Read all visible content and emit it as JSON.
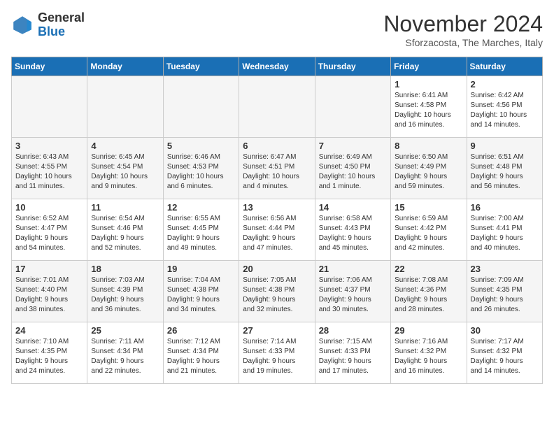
{
  "logo": {
    "general": "General",
    "blue": "Blue"
  },
  "title": "November 2024",
  "subtitle": "Sforzacosta, The Marches, Italy",
  "headers": [
    "Sunday",
    "Monday",
    "Tuesday",
    "Wednesday",
    "Thursday",
    "Friday",
    "Saturday"
  ],
  "weeks": [
    [
      {
        "day": "",
        "info": ""
      },
      {
        "day": "",
        "info": ""
      },
      {
        "day": "",
        "info": ""
      },
      {
        "day": "",
        "info": ""
      },
      {
        "day": "",
        "info": ""
      },
      {
        "day": "1",
        "info": "Sunrise: 6:41 AM\nSunset: 4:58 PM\nDaylight: 10 hours\nand 16 minutes."
      },
      {
        "day": "2",
        "info": "Sunrise: 6:42 AM\nSunset: 4:56 PM\nDaylight: 10 hours\nand 14 minutes."
      }
    ],
    [
      {
        "day": "3",
        "info": "Sunrise: 6:43 AM\nSunset: 4:55 PM\nDaylight: 10 hours\nand 11 minutes."
      },
      {
        "day": "4",
        "info": "Sunrise: 6:45 AM\nSunset: 4:54 PM\nDaylight: 10 hours\nand 9 minutes."
      },
      {
        "day": "5",
        "info": "Sunrise: 6:46 AM\nSunset: 4:53 PM\nDaylight: 10 hours\nand 6 minutes."
      },
      {
        "day": "6",
        "info": "Sunrise: 6:47 AM\nSunset: 4:51 PM\nDaylight: 10 hours\nand 4 minutes."
      },
      {
        "day": "7",
        "info": "Sunrise: 6:49 AM\nSunset: 4:50 PM\nDaylight: 10 hours\nand 1 minute."
      },
      {
        "day": "8",
        "info": "Sunrise: 6:50 AM\nSunset: 4:49 PM\nDaylight: 9 hours\nand 59 minutes."
      },
      {
        "day": "9",
        "info": "Sunrise: 6:51 AM\nSunset: 4:48 PM\nDaylight: 9 hours\nand 56 minutes."
      }
    ],
    [
      {
        "day": "10",
        "info": "Sunrise: 6:52 AM\nSunset: 4:47 PM\nDaylight: 9 hours\nand 54 minutes."
      },
      {
        "day": "11",
        "info": "Sunrise: 6:54 AM\nSunset: 4:46 PM\nDaylight: 9 hours\nand 52 minutes."
      },
      {
        "day": "12",
        "info": "Sunrise: 6:55 AM\nSunset: 4:45 PM\nDaylight: 9 hours\nand 49 minutes."
      },
      {
        "day": "13",
        "info": "Sunrise: 6:56 AM\nSunset: 4:44 PM\nDaylight: 9 hours\nand 47 minutes."
      },
      {
        "day": "14",
        "info": "Sunrise: 6:58 AM\nSunset: 4:43 PM\nDaylight: 9 hours\nand 45 minutes."
      },
      {
        "day": "15",
        "info": "Sunrise: 6:59 AM\nSunset: 4:42 PM\nDaylight: 9 hours\nand 42 minutes."
      },
      {
        "day": "16",
        "info": "Sunrise: 7:00 AM\nSunset: 4:41 PM\nDaylight: 9 hours\nand 40 minutes."
      }
    ],
    [
      {
        "day": "17",
        "info": "Sunrise: 7:01 AM\nSunset: 4:40 PM\nDaylight: 9 hours\nand 38 minutes."
      },
      {
        "day": "18",
        "info": "Sunrise: 7:03 AM\nSunset: 4:39 PM\nDaylight: 9 hours\nand 36 minutes."
      },
      {
        "day": "19",
        "info": "Sunrise: 7:04 AM\nSunset: 4:38 PM\nDaylight: 9 hours\nand 34 minutes."
      },
      {
        "day": "20",
        "info": "Sunrise: 7:05 AM\nSunset: 4:38 PM\nDaylight: 9 hours\nand 32 minutes."
      },
      {
        "day": "21",
        "info": "Sunrise: 7:06 AM\nSunset: 4:37 PM\nDaylight: 9 hours\nand 30 minutes."
      },
      {
        "day": "22",
        "info": "Sunrise: 7:08 AM\nSunset: 4:36 PM\nDaylight: 9 hours\nand 28 minutes."
      },
      {
        "day": "23",
        "info": "Sunrise: 7:09 AM\nSunset: 4:35 PM\nDaylight: 9 hours\nand 26 minutes."
      }
    ],
    [
      {
        "day": "24",
        "info": "Sunrise: 7:10 AM\nSunset: 4:35 PM\nDaylight: 9 hours\nand 24 minutes."
      },
      {
        "day": "25",
        "info": "Sunrise: 7:11 AM\nSunset: 4:34 PM\nDaylight: 9 hours\nand 22 minutes."
      },
      {
        "day": "26",
        "info": "Sunrise: 7:12 AM\nSunset: 4:34 PM\nDaylight: 9 hours\nand 21 minutes."
      },
      {
        "day": "27",
        "info": "Sunrise: 7:14 AM\nSunset: 4:33 PM\nDaylight: 9 hours\nand 19 minutes."
      },
      {
        "day": "28",
        "info": "Sunrise: 7:15 AM\nSunset: 4:33 PM\nDaylight: 9 hours\nand 17 minutes."
      },
      {
        "day": "29",
        "info": "Sunrise: 7:16 AM\nSunset: 4:32 PM\nDaylight: 9 hours\nand 16 minutes."
      },
      {
        "day": "30",
        "info": "Sunrise: 7:17 AM\nSunset: 4:32 PM\nDaylight: 9 hours\nand 14 minutes."
      }
    ]
  ]
}
